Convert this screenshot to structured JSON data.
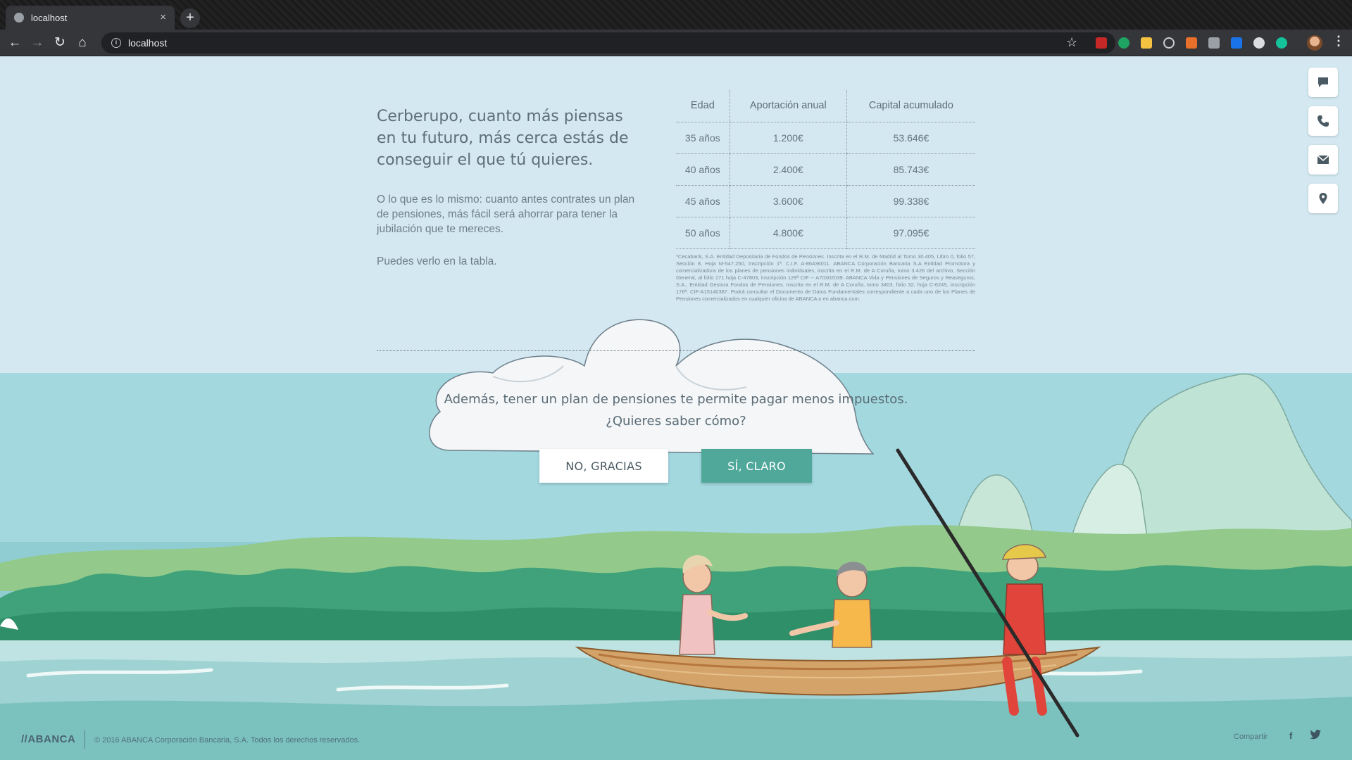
{
  "browser": {
    "tab_title": "localhost",
    "new_tab": "+",
    "close": "×",
    "url": "localhost"
  },
  "intro": {
    "headline": "Cerberupo, cuanto más piensas en tu futuro, más cerca estás de conseguir el que tú quieres.",
    "body": "O lo que es lo mismo: cuanto antes contrates un plan de pensiones, más fácil será ahorrar para tener la jubilación que te mereces.",
    "note": "Puedes verlo en la tabla."
  },
  "table": {
    "headers": [
      "Edad",
      "Aportación anual",
      "Capital acumulado"
    ],
    "rows": [
      [
        "35 años",
        "1.200€",
        "53.646€"
      ],
      [
        "40 años",
        "2.400€",
        "85.743€"
      ],
      [
        "45 años",
        "3.600€",
        "99.338€"
      ],
      [
        "50 años",
        "4.800€",
        "97.095€"
      ]
    ]
  },
  "disclaimer": "*Cecabank, S.A. Entidad Depositaria de Fondos de Pensiones. Inscrita en el R.M. de Madrid al Tomo 30.405, Libro 0, folio 57, Sección 8, Hoja M-547.250, Inscripción 1ª. C.I.F. A-86436011. ABANCA Corporación Bancaria S.A Entidad Promotora y comercializadora de los planes de pensiones individuales, inscrita en el R.M. de A Coruña, tomo 3.426 del archivo, Sección General, al folio 171 hoja C-47803, inscripción 129ª CIF -- A70302039. ABANCA Vida y Pensiones de Seguros y Reaseguros, S.A., Entidad Gestora Fondos de Pensiones. Inscrita en el R.M. de A Coruña, tomo 3403, folio 32, hoja C-6245, inscripción 176ª. CIF-A15140387. Podrá consultar el Documento de Datos Fundamentales correspondiente a cada uno de los Planes de Pensiones comercializados en cualquier oficina de ABANCA o en abanca.com.",
  "question": {
    "line1": "Además, tener un plan de pensiones te permite pagar menos impuestos.",
    "line2": "¿Quieres saber cómo?"
  },
  "buttons": {
    "no": "NO, GRACIAS",
    "yes": "SÍ, CLARO"
  },
  "footer": {
    "logo": "//ABANCA",
    "copyright": "© 2016 ABANCA Corporación Bancaria, S.A. Todos los derechos reservados.",
    "share": "Compartir",
    "facebook": "f"
  },
  "side_icons": [
    "chat-icon",
    "phone-icon",
    "mail-icon",
    "location-icon"
  ],
  "colors": {
    "accent": "#4fa89a",
    "sky": "#d3e8f0",
    "sea": "#a3d8df",
    "text": "#5e6f7a"
  }
}
